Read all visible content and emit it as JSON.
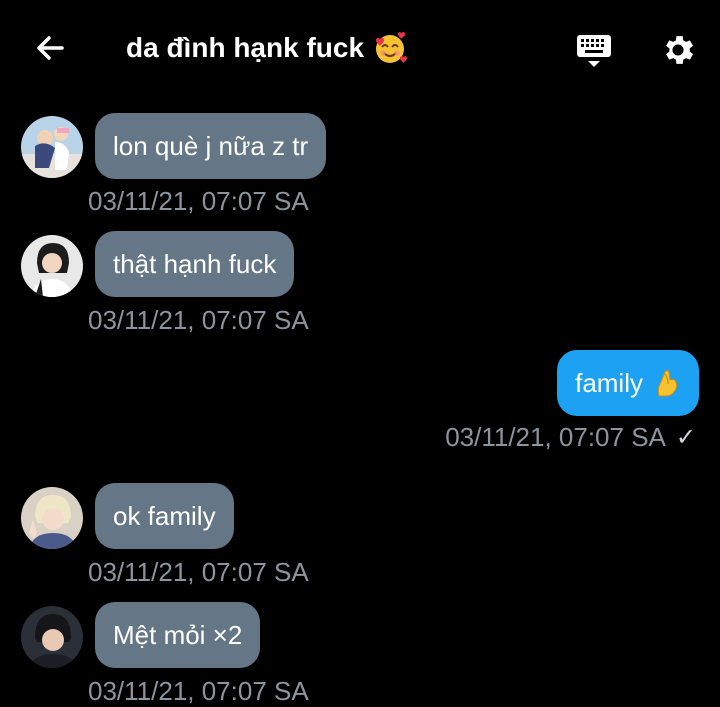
{
  "header": {
    "title": "da đình hạnk fuck",
    "title_emoji": "smiling-face-with-hearts-icon",
    "back_icon": "arrow-left-icon",
    "keyboard_icon": "keyboard-icon",
    "settings_icon": "gear-icon"
  },
  "colors": {
    "background": "#000000",
    "incoming_bubble": "#657786",
    "outgoing_bubble": "#1da1f2",
    "timestamp": "#8c949c"
  },
  "messages": [
    {
      "text": "lon què j nữa z tr",
      "time": "03/11/21, 07:07 SA",
      "direction": "incoming"
    },
    {
      "text": "thật hạnh fuck",
      "time": "03/11/21, 07:07 SA",
      "direction": "incoming"
    },
    {
      "text": "family",
      "emoji": "pinched-fingers-icon",
      "time": "03/11/21, 07:07 SA",
      "direction": "outgoing",
      "status": "✓"
    },
    {
      "text": "ok family",
      "time": "03/11/21, 07:07 SA",
      "direction": "incoming"
    },
    {
      "text": "Mệt mỏi ×2",
      "time": "03/11/21, 07:07 SA",
      "direction": "incoming"
    }
  ]
}
